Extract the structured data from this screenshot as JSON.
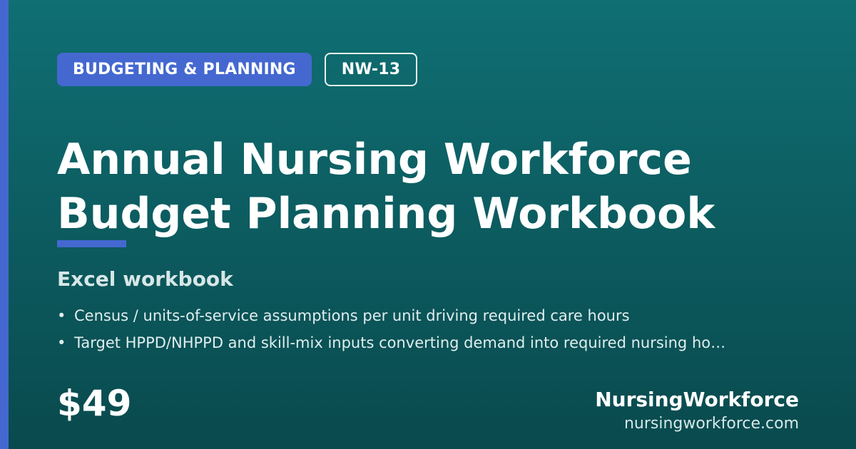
{
  "badges": {
    "category": "BUDGETING & PLANNING",
    "code": "NW-13"
  },
  "product": {
    "title": "Annual Nursing Workforce Budget Planning Workbook",
    "format": "Excel workbook",
    "features": [
      "Census / units-of-service assumptions per unit driving required care hours",
      "Target HPPD/NHPPD and skill-mix inputs converting demand into required nursing ho…"
    ],
    "price": "$49"
  },
  "brand": {
    "name": "NursingWorkforce",
    "url": "nursingworkforce.com"
  },
  "colors": {
    "accent": "#4468d0",
    "background_top": "#0f6f73",
    "background_bottom": "#094a4e"
  }
}
